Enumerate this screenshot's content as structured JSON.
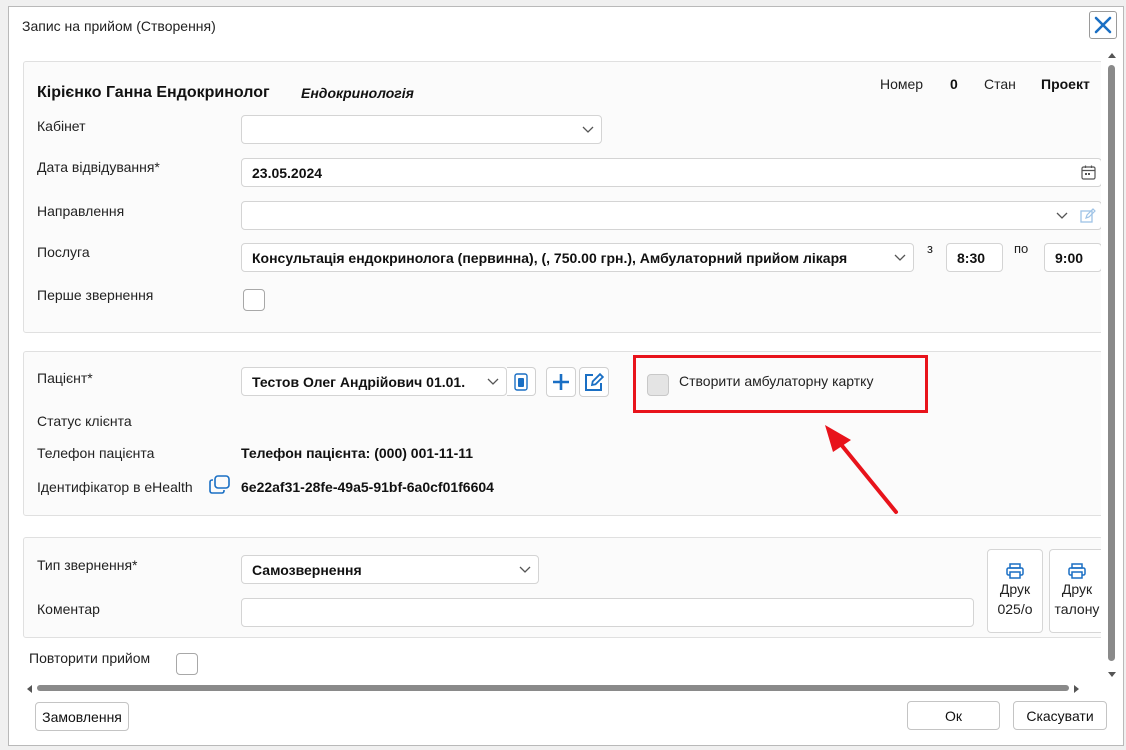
{
  "window": {
    "title": "Запис на прийом (Створення)"
  },
  "header": {
    "doctor_name": "Кірієнко Ганна Ендокринолог",
    "specialty": "Ендокринологія",
    "number_label": "Номер",
    "number_value": "0",
    "state_label": "Стан",
    "state_value": "Проект"
  },
  "form": {
    "cabinet": {
      "label": "Кабінет",
      "value": ""
    },
    "visit_date": {
      "label": "Дата відвідування*",
      "value": "23.05.2024"
    },
    "referral": {
      "label": "Направлення",
      "value": ""
    },
    "service": {
      "label": "Послуга",
      "value": "Консультація ендокринолога (первинна), (, 750.00 грн.), Амбулаторний прийом лікаря",
      "from_label": "з",
      "from_value": "8:30",
      "to_label": "по",
      "to_value": "9:00"
    },
    "first_visit": {
      "label": "Перше звернення",
      "checked": false
    }
  },
  "patient": {
    "label": "Пацієнт*",
    "value": "Тестов Олег Андрійович 01.01.",
    "create_card_label": "Створити амбулаторну картку",
    "client_status_label": "Статус клієнта",
    "phone_label": "Телефон пацієнта",
    "phone_value": "Телефон пацієнта: (000) 001-11-11",
    "ehealth_label": "Ідентифікатор в eHealth",
    "ehealth_value": "6e22af31-28fe-49a5-91bf-6a0cf01f6604"
  },
  "appeal": {
    "type_label": "Тип звернення*",
    "type_value": "Самозвернення",
    "comment_label": "Коментар",
    "comment_value": "",
    "print_025": {
      "line1": "Друк",
      "line2": "025/о"
    },
    "print_ticket": {
      "line1": "Друк",
      "line2": "талону"
    }
  },
  "repeat": {
    "label": "Повторити прийом",
    "checked": false
  },
  "footer": {
    "order_label": "Замовлення",
    "ok_label": "Ок",
    "cancel_label": "Скасувати"
  },
  "colors": {
    "accent": "#1a6fc4",
    "highlight": "#e8131b"
  },
  "icons": {
    "close": "close-icon",
    "chevron": "chevron-down-icon",
    "calendar": "calendar-icon",
    "edit": "edit-icon",
    "card": "card-icon",
    "plus": "plus-icon",
    "copy": "copy-icon",
    "printer": "printer-icon"
  }
}
